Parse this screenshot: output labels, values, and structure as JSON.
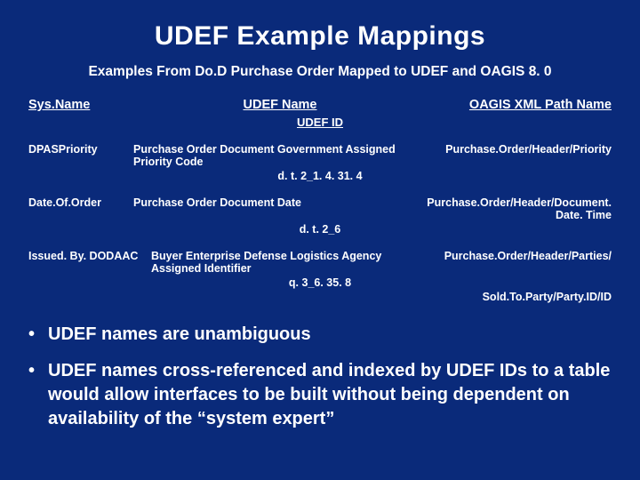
{
  "title": "UDEF Example Mappings",
  "subtitle": "Examples From Do.D Purchase Order Mapped to UDEF and OAGIS 8. 0",
  "headers": {
    "sys": "Sys.Name",
    "udef": "UDEF Name",
    "udef_id": "UDEF ID",
    "oagis": "OAGIS XML Path Name"
  },
  "rows": [
    {
      "sys": "DPASPriority",
      "udef": "Purchase Order Document Government Assigned Priority Code",
      "id": "d. t. 2_1. 4. 31. 4",
      "oagis": "Purchase.Order/Header/Priority",
      "oagis2": ""
    },
    {
      "sys": "Date.Of.Order",
      "udef": "Purchase Order Document Date",
      "id": "d. t. 2_6",
      "oagis": "Purchase.Order/Header/Document. Date. Time",
      "oagis2": ""
    },
    {
      "sys": "Issued. By. DODAAC",
      "udef": "Buyer Enterprise Defense Logistics Agency Assigned Identifier",
      "id": "q. 3_6. 35. 8",
      "oagis": "Purchase.Order/Header/Parties/",
      "oagis2": "Sold.To.Party/Party.ID/ID"
    }
  ],
  "bullets": [
    "UDEF names are unambiguous",
    "UDEF names cross-referenced and indexed by UDEF IDs to a table would allow interfaces to be built without being dependent on availability of the “system expert”"
  ]
}
